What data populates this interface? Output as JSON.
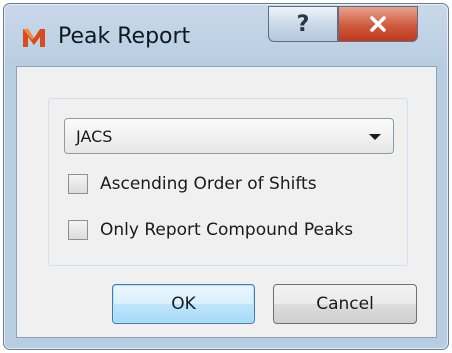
{
  "window": {
    "title": "Peak Report",
    "app_icon": "mnova-m-icon",
    "help_icon": "help-icon",
    "close_icon": "close-icon",
    "colors": {
      "accent_close": "#c0391f",
      "default_button": "#3c7fb1"
    }
  },
  "form": {
    "format_select": {
      "value": "JACS"
    },
    "options": [
      {
        "label": "Ascending Order of Shifts",
        "checked": false
      },
      {
        "label": "Only Report Compound Peaks",
        "checked": false
      }
    ]
  },
  "buttons": {
    "ok": "OK",
    "cancel": "Cancel"
  }
}
